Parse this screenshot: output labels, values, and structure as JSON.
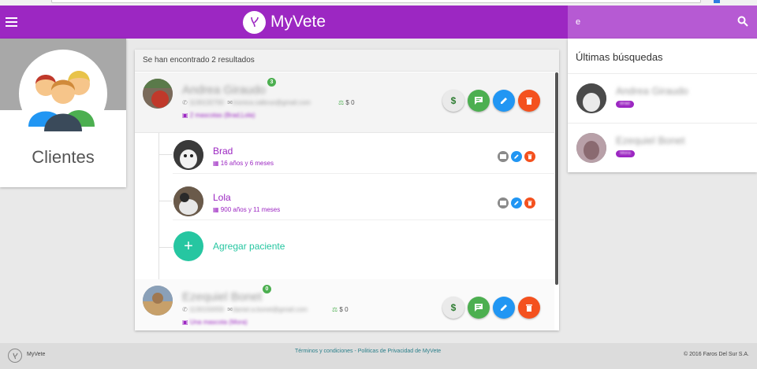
{
  "app": {
    "brand": "MyVete"
  },
  "search": {
    "value": "e"
  },
  "clients_card": {
    "label": "Clientes"
  },
  "results": {
    "header": "Se han encontrado 2 resultados",
    "clients": [
      {
        "name": "Andrea Giraudo",
        "badge": "3",
        "phone": "1130132700",
        "email": "monica.calbruo@gmail.com",
        "balance": "$ 0",
        "pets_summary": "2 mascotas (Brad,Lola)",
        "money_label": "$"
      },
      {
        "name": "Ezequiel Bonet",
        "badge": "0",
        "phone": "1130150059",
        "email": "daniel.a.bonet@gmail.com",
        "balance": "$ 0",
        "pets_summary": "Una mascota (Mora)",
        "money_label": "$"
      }
    ],
    "pets": [
      {
        "name": "Brad",
        "age": "16 años y 6 meses"
      },
      {
        "name": "Lola",
        "age": "900 años y 11 meses"
      }
    ],
    "add_patient": "Agregar paciente"
  },
  "recent": {
    "title": "Últimas búsquedas",
    "items": [
      {
        "name": "Andrea Giraudo",
        "tag": "Brad"
      },
      {
        "name": "Ezequiel Bonet",
        "tag": "Mora"
      }
    ]
  },
  "footer": {
    "brand": "MyVete",
    "links": "Términos y condiciones - Politicas de Privacidad de MyVete",
    "copyright": "© 2016 Faros Del Sur S.A."
  },
  "colors": {
    "primary": "#9c27c2",
    "search_bg": "#b65ad3",
    "accent_green": "#4caf50",
    "accent_blue": "#2196f3",
    "accent_red": "#f4511e",
    "teal": "#26c6a1"
  }
}
